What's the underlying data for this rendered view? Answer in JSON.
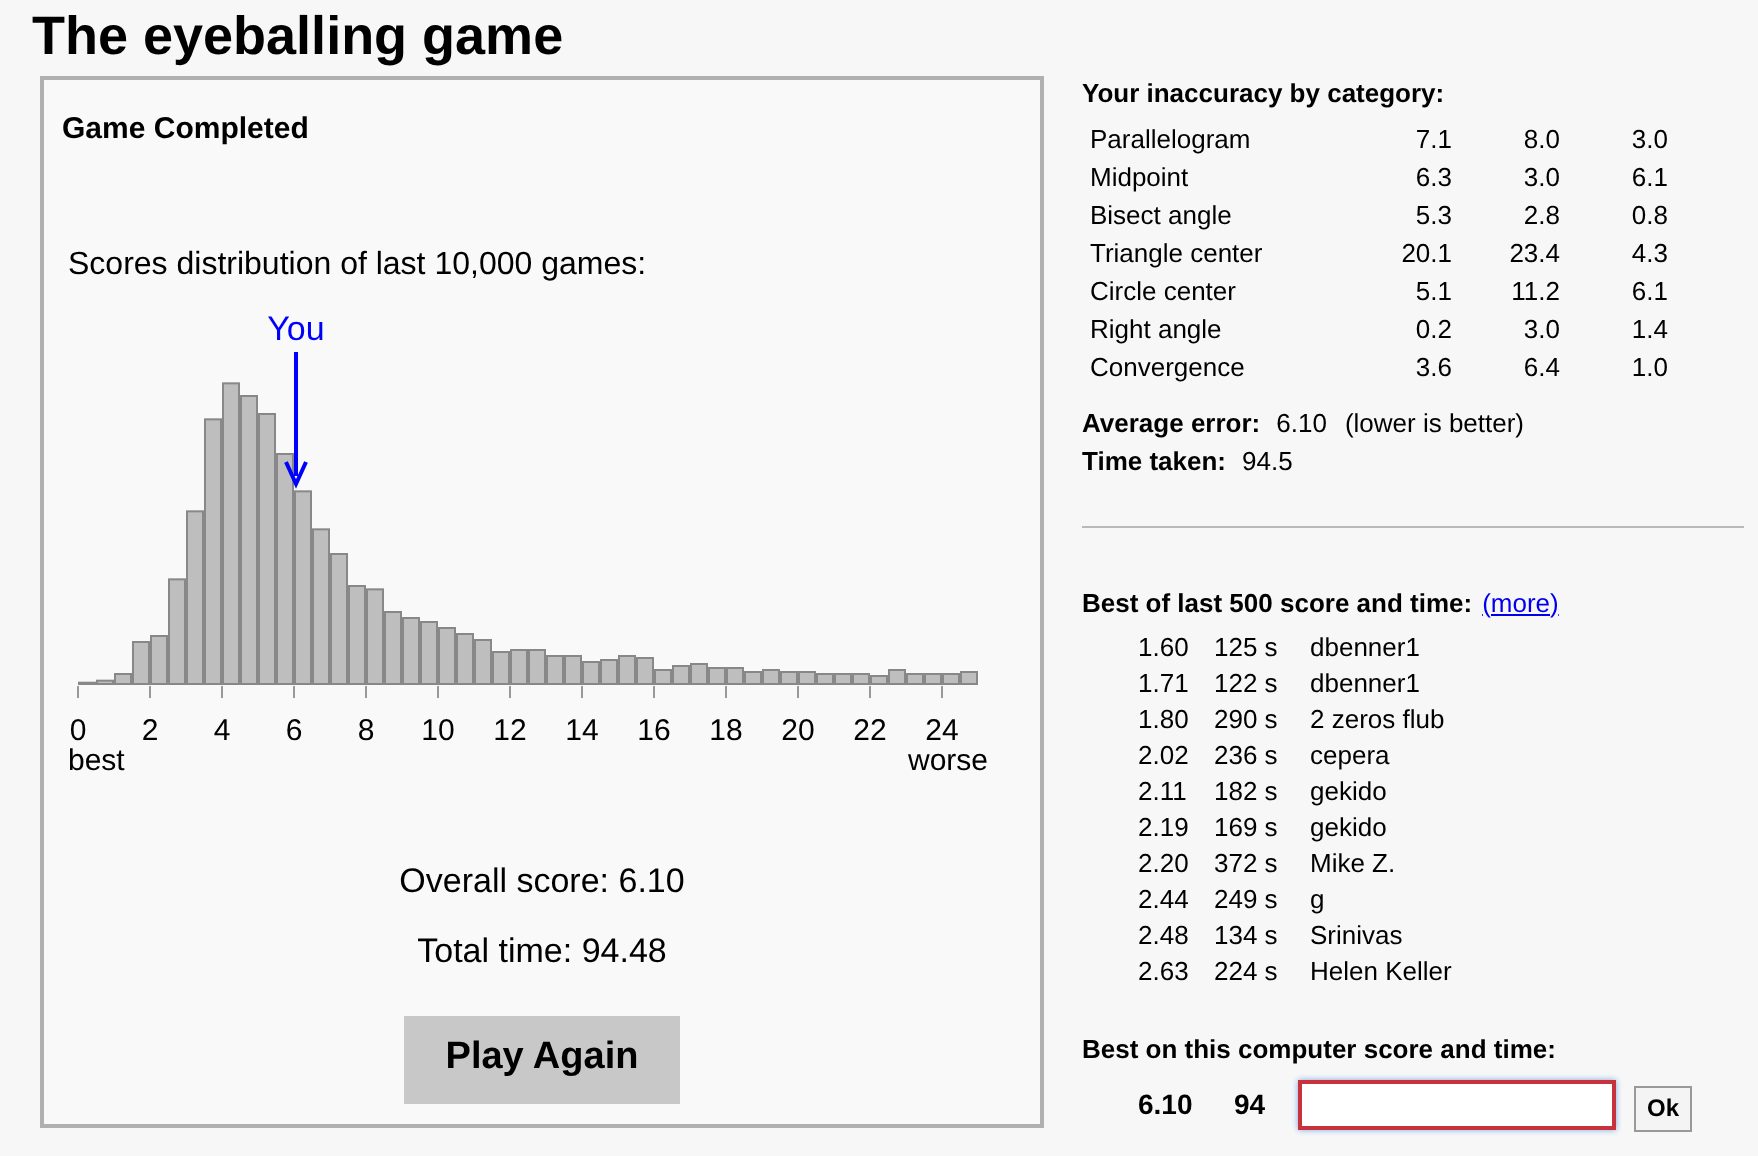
{
  "title": "The eyeballing game",
  "game_panel": {
    "heading": "Game Completed",
    "chart_caption": "Scores distribution of last 10,000 games:",
    "marker_label": "You",
    "x_tick_labels": [
      "0",
      "2",
      "4",
      "6",
      "8",
      "10",
      "12",
      "14",
      "16",
      "18",
      "20",
      "22",
      "24"
    ],
    "axis_start_label": "best",
    "axis_end_label": "worse",
    "overall_score": "Overall score: 6.10",
    "total_time": "Total time: 94.48",
    "button": "Play Again"
  },
  "inaccuracy": {
    "heading": "Your inaccuracy by category:",
    "rows": [
      {
        "category": "Parallelogram",
        "values": [
          "7.1",
          "8.0",
          "3.0"
        ]
      },
      {
        "category": "Midpoint",
        "values": [
          "6.3",
          "3.0",
          "6.1"
        ]
      },
      {
        "category": "Bisect angle",
        "values": [
          "5.3",
          "2.8",
          "0.8"
        ]
      },
      {
        "category": "Triangle center",
        "values": [
          "20.1",
          "23.4",
          "4.3"
        ]
      },
      {
        "category": "Circle center",
        "values": [
          "5.1",
          "11.2",
          "6.1"
        ]
      },
      {
        "category": "Right angle",
        "values": [
          "0.2",
          "3.0",
          "1.4"
        ]
      },
      {
        "category": "Convergence",
        "values": [
          "3.6",
          "6.4",
          "1.0"
        ]
      }
    ],
    "average_error_label": "Average error:",
    "average_error": "6.10",
    "average_error_note": "(lower is better)",
    "time_taken_label": "Time taken:",
    "time_taken": "94.5"
  },
  "leaderboard": {
    "heading": "Best of last 500 score and time:",
    "more_link": "(more)",
    "rows": [
      {
        "score": "1.60",
        "time": "125 s",
        "name": "dbenner1"
      },
      {
        "score": "1.71",
        "time": "122 s",
        "name": "dbenner1"
      },
      {
        "score": "1.80",
        "time": "290 s",
        "name": "2 zeros flub"
      },
      {
        "score": "2.02",
        "time": "236 s",
        "name": "cepera"
      },
      {
        "score": "2.11",
        "time": "182 s",
        "name": "gekido"
      },
      {
        "score": "2.19",
        "time": "169 s",
        "name": "gekido"
      },
      {
        "score": "2.20",
        "time": "372 s",
        "name": "Mike Z."
      },
      {
        "score": "2.44",
        "time": "249 s",
        "name": "g"
      },
      {
        "score": "2.48",
        "time": "134 s",
        "name": "Srinivas"
      },
      {
        "score": "2.63",
        "time": "224 s",
        "name": "Helen Keller"
      }
    ]
  },
  "local_best": {
    "heading": "Best on this computer score and time:",
    "score": "6.10",
    "time": "94",
    "button": "Ok"
  }
}
